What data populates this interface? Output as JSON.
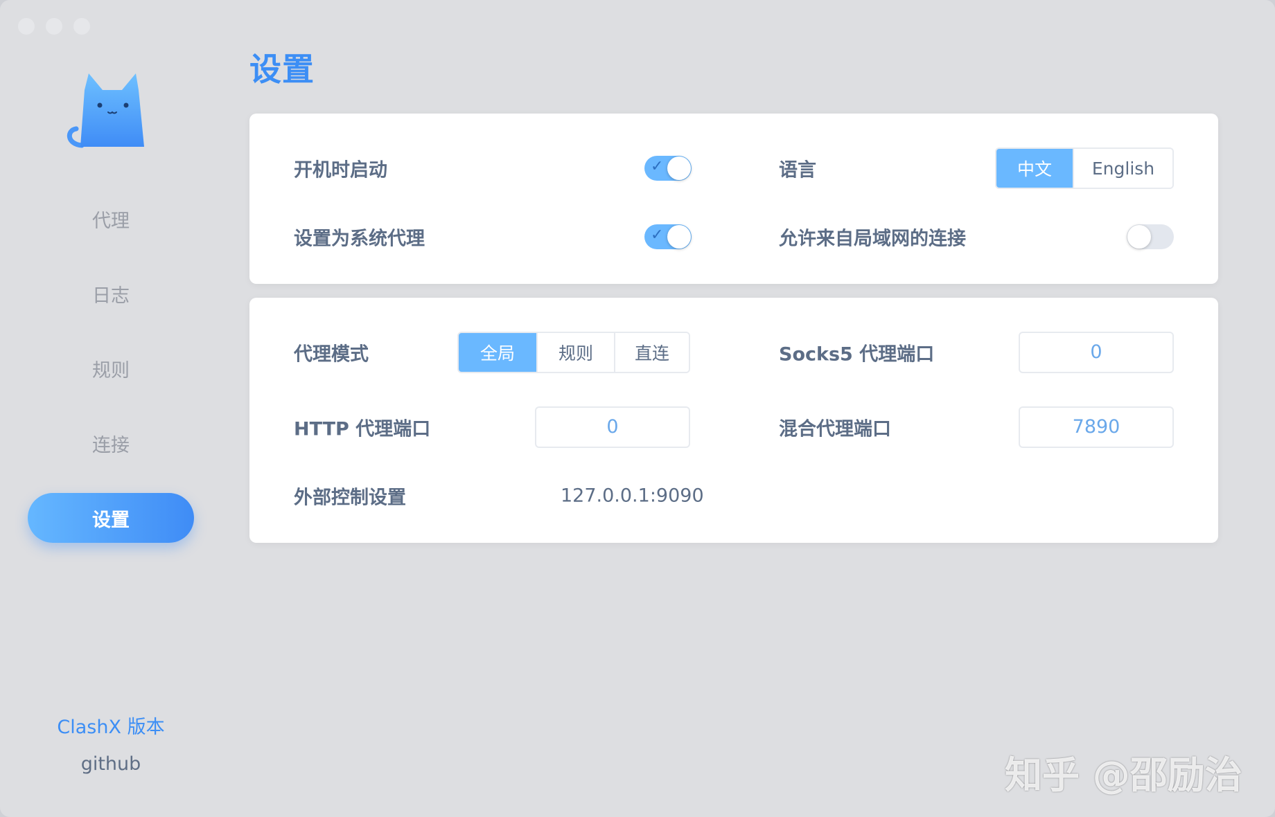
{
  "sidebar": {
    "items": [
      {
        "label": "代理"
      },
      {
        "label": "日志"
      },
      {
        "label": "规则"
      },
      {
        "label": "连接"
      },
      {
        "label": "设置"
      }
    ],
    "active_index": 4,
    "version_link": "ClashX 版本",
    "github_link": "github"
  },
  "main": {
    "title": "设置",
    "general": {
      "launch_at_login": {
        "label": "开机时启动",
        "enabled": true
      },
      "system_proxy": {
        "label": "设置为系统代理",
        "enabled": true
      },
      "language": {
        "label": "语言",
        "options": [
          "中文",
          "English"
        ],
        "selected": "中文"
      },
      "allow_lan": {
        "label": "允许来自局域网的连接",
        "enabled": false
      }
    },
    "proxy": {
      "mode": {
        "label": "代理模式",
        "options": [
          "全局",
          "规则",
          "直连"
        ],
        "selected": "全局"
      },
      "socks5_port": {
        "label": "Socks5 代理端口",
        "value": "0"
      },
      "http_port": {
        "label": "HTTP 代理端口",
        "value": "0"
      },
      "mixed_port": {
        "label": "混合代理端口",
        "value": "7890"
      },
      "external_controller": {
        "label": "外部控制设置",
        "value": "127.0.0.1:9090"
      }
    }
  },
  "watermark": "知乎 @邵励治",
  "colors": {
    "accent": "#3c8ef5",
    "toggle_on": "#6ab8ff",
    "background": "#dddee1"
  }
}
